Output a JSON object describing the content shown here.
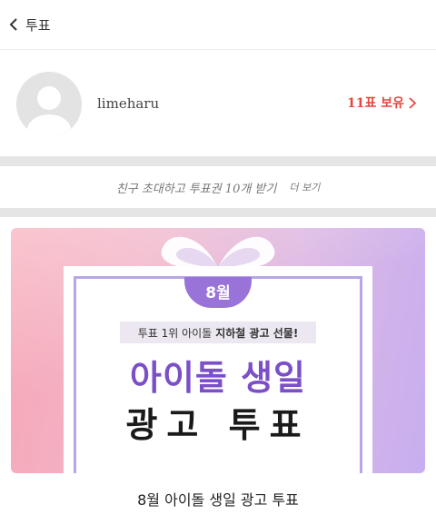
{
  "header": {
    "title": "투표"
  },
  "profile": {
    "username": "limeharu",
    "votes_label": "11표 보유"
  },
  "invite": {
    "text": "친구 초대하고 투표권 10개 받기",
    "more": "더 보기"
  },
  "banner": {
    "month_badge": "8월",
    "tagline_prefix": "투표 1위 아이돌",
    "tagline_bold": "지하철 광고 선물!",
    "headline_line1": "아이돌 생일",
    "headline_line2": "광고 투표"
  },
  "card": {
    "title": "8월 아이돌 생일 광고 투표"
  },
  "colors": {
    "accent_red": "#e3483f",
    "purple": "#7a4fc8",
    "badge_purple": "#9a73d9"
  },
  "icons": {
    "back": "chevron-left-icon",
    "forward": "chevron-right-icon",
    "avatar": "default-avatar-icon",
    "bow": "gift-bow-icon"
  }
}
